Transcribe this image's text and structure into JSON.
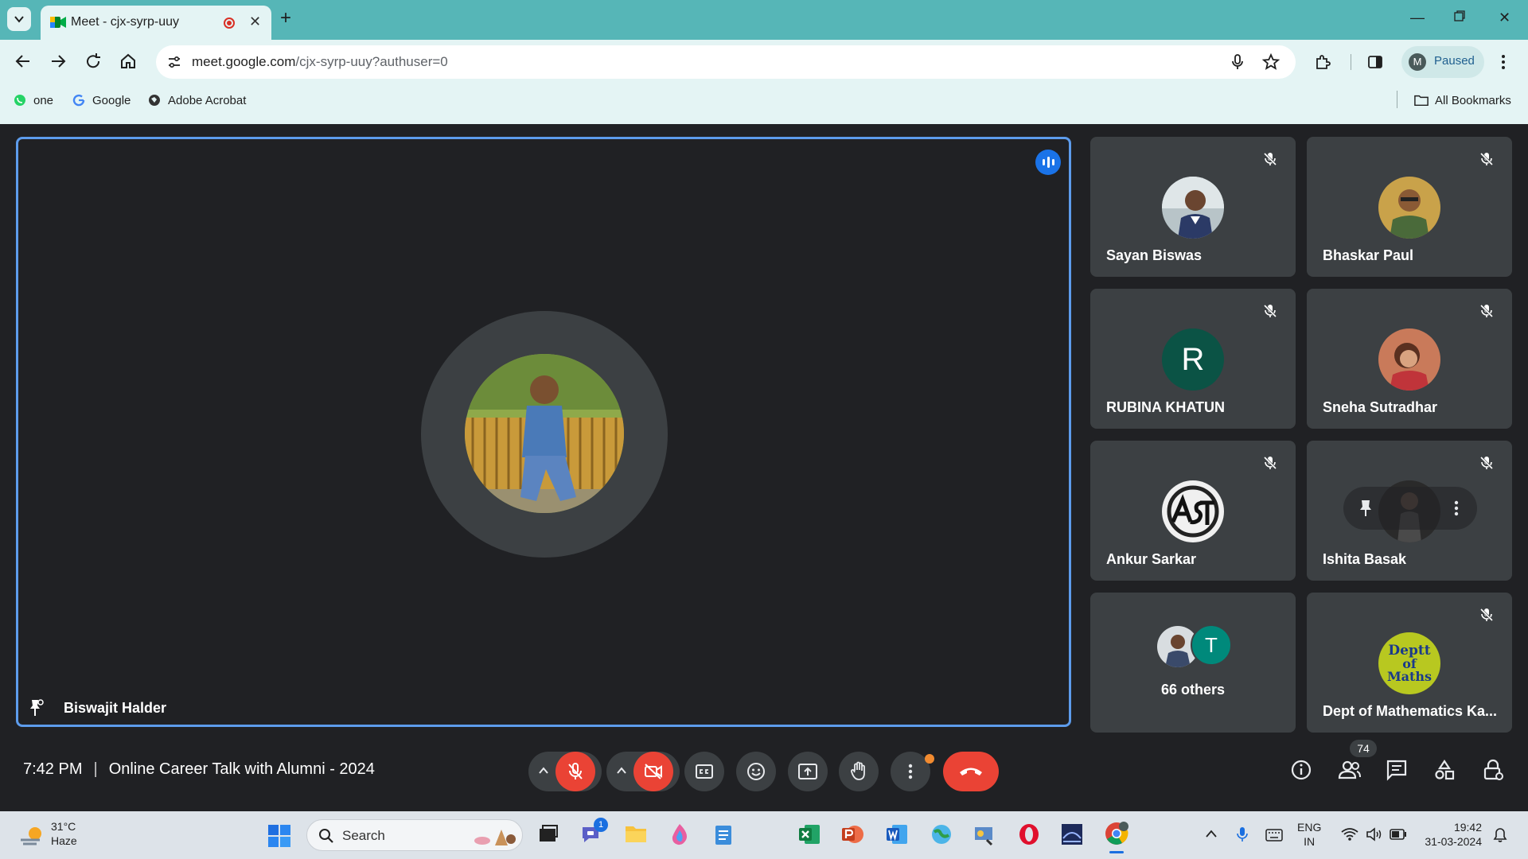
{
  "browser": {
    "tab_title": "Meet - cjx-syrp-uuy",
    "url_host": "meet.google.com",
    "url_path": "/cjx-syrp-uuy?authuser=0",
    "profile_initial": "M",
    "profile_status": "Paused",
    "bookmarks": [
      "one",
      "Google",
      "Adobe Acrobat"
    ],
    "all_bookmarks": "All Bookmarks"
  },
  "meet": {
    "main_speaker": "Biswajit Halder",
    "participants": [
      {
        "name": "Sayan Biswas",
        "muted": true
      },
      {
        "name": "Bhaskar Paul",
        "muted": true
      },
      {
        "name": "RUBINA KHATUN",
        "initial": "R",
        "muted": true
      },
      {
        "name": "Sneha Sutradhar",
        "muted": true
      },
      {
        "name": "Ankur Sarkar",
        "muted": true
      },
      {
        "name": "Ishita Basak",
        "muted": true
      }
    ],
    "others": {
      "label": "66 others",
      "initial": "T"
    },
    "dept_tile": {
      "name": "Dept of Mathematics Ka...",
      "logo_text": [
        "Deptt",
        "of",
        "Maths"
      ]
    },
    "time": "7:42 PM",
    "meeting_title": "Online Career Talk with Alumni - 2024",
    "people_count": "74"
  },
  "taskbar": {
    "weather_temp": "31°C",
    "weather_desc": "Haze",
    "search_label": "Search",
    "chat_badge": "1",
    "lang_top": "ENG",
    "lang_bottom": "IN",
    "clock_time": "19:42",
    "clock_date": "31-03-2024"
  },
  "colors": {
    "tab_strip": "#56b6b7",
    "meet_bg": "#202124",
    "tile_bg": "#3c4043",
    "end_call_red": "#ea4335",
    "speaking_blue": "#1a73e8"
  }
}
